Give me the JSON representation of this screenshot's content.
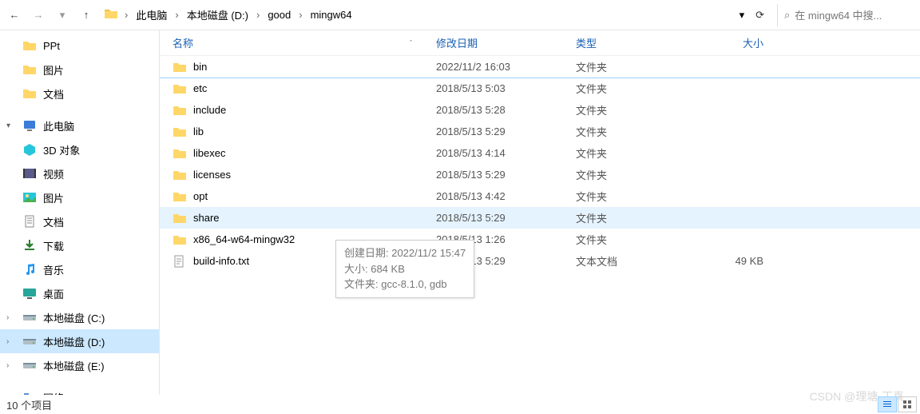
{
  "nav": {
    "back": "←",
    "forward": "→",
    "recent": "▾",
    "up": "↑"
  },
  "breadcrumb": {
    "items": [
      "此电脑",
      "本地磁盘 (D:)",
      "good",
      "mingw64"
    ],
    "dropdown": "▾",
    "refresh": "⟳"
  },
  "search": {
    "placeholder": "在 mingw64 中搜...",
    "icon": "⌕"
  },
  "sidebar": {
    "items": [
      {
        "label": "PPt",
        "icon": "folder",
        "chev": ""
      },
      {
        "label": "图片",
        "icon": "folder",
        "chev": ""
      },
      {
        "label": "文档",
        "icon": "folder",
        "chev": ""
      },
      {
        "label": "此电脑",
        "icon": "pc",
        "chev": "▾",
        "group": true
      },
      {
        "label": "3D 对象",
        "icon": "3d",
        "chev": ""
      },
      {
        "label": "视频",
        "icon": "video",
        "chev": ""
      },
      {
        "label": "图片",
        "icon": "pictures",
        "chev": ""
      },
      {
        "label": "文档",
        "icon": "docs",
        "chev": ""
      },
      {
        "label": "下载",
        "icon": "downloads",
        "chev": ""
      },
      {
        "label": "音乐",
        "icon": "music",
        "chev": ""
      },
      {
        "label": "桌面",
        "icon": "desktop",
        "chev": ""
      },
      {
        "label": "本地磁盘 (C:)",
        "icon": "drive",
        "chev": "›"
      },
      {
        "label": "本地磁盘 (D:)",
        "icon": "drive",
        "chev": "›",
        "selected": true
      },
      {
        "label": "本地磁盘 (E:)",
        "icon": "drive",
        "chev": "›"
      },
      {
        "label": "网络",
        "icon": "network",
        "chev": "›",
        "group": true
      }
    ]
  },
  "headers": {
    "name": "名称",
    "date": "修改日期",
    "type": "类型",
    "size": "大小",
    "sort": "ˆ"
  },
  "files": [
    {
      "name": "bin",
      "date": "2022/11/2 16:03",
      "type": "文件夹",
      "size": "",
      "icon": "folder",
      "selected": true
    },
    {
      "name": "etc",
      "date": "2018/5/13 5:03",
      "type": "文件夹",
      "size": "",
      "icon": "folder"
    },
    {
      "name": "include",
      "date": "2018/5/13 5:28",
      "type": "文件夹",
      "size": "",
      "icon": "folder"
    },
    {
      "name": "lib",
      "date": "2018/5/13 5:29",
      "type": "文件夹",
      "size": "",
      "icon": "folder"
    },
    {
      "name": "libexec",
      "date": "2018/5/13 4:14",
      "type": "文件夹",
      "size": "",
      "icon": "folder"
    },
    {
      "name": "licenses",
      "date": "2018/5/13 5:29",
      "type": "文件夹",
      "size": "",
      "icon": "folder"
    },
    {
      "name": "opt",
      "date": "2018/5/13 4:42",
      "type": "文件夹",
      "size": "",
      "icon": "folder"
    },
    {
      "name": "share",
      "date": "2018/5/13 5:29",
      "type": "文件夹",
      "size": "",
      "icon": "folder",
      "hovered": true
    },
    {
      "name": "x86_64-w64-mingw32",
      "date": "2018/5/13 1:26",
      "type": "文件夹",
      "size": "",
      "icon": "folder"
    },
    {
      "name": "build-info.txt",
      "date": "2018/5/13 5:29",
      "type": "文本文档",
      "size": "49 KB",
      "icon": "txt"
    }
  ],
  "tooltip": {
    "line1": "创建日期: 2022/11/2 15:47",
    "line2": "大小: 684 KB",
    "line3": "文件夹: gcc-8.1.0, gdb"
  },
  "status": {
    "count": "10 个项目"
  },
  "watermark": "CSDN @理塘·丁真"
}
